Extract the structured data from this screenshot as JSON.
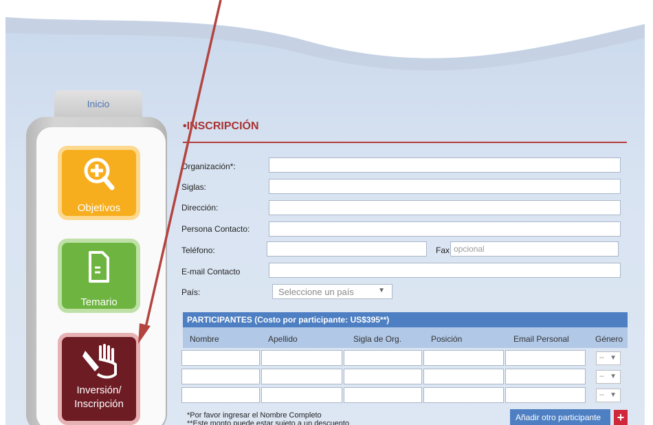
{
  "nav": {
    "home_tab": "Inicio",
    "tiles": [
      {
        "label": "Objetivos",
        "icon": "magnifier-plus-icon",
        "color": "#f7ae1e"
      },
      {
        "label": "Temario",
        "icon": "document-icon",
        "color": "#6eb440"
      },
      {
        "label_line1": "Inversión/",
        "label_line2": "Inscripción",
        "icon": "hand-writing-icon",
        "color": "#6d1c24"
      }
    ]
  },
  "form": {
    "title": "INSCRIPCIÓN",
    "fields": {
      "organizacion": "Organización*:",
      "siglas": "Siglas:",
      "direccion": "Dirección:",
      "persona": "Persona Contacto:",
      "telefono": "Teléfono:",
      "fax": "Fax:",
      "fax_placeholder": "opcional",
      "email": "E-mail Contacto",
      "pais": "País:",
      "pais_select": "Seleccione un país"
    }
  },
  "participants": {
    "header": "PARTICIPANTES (Costo por participante: US$395**)",
    "columns": [
      "Nombre",
      "Apellido",
      "Sigla de Org.",
      "Posición",
      "Email Personal",
      "Género"
    ],
    "gender_placeholder": "--",
    "note1": "*Por favor ingresar el Nombre Completo",
    "note2": "**Este monto puede estar sujeto a un descuento",
    "add_button": "Añadir otro participante",
    "plus": "+"
  },
  "colors": {
    "accent": "#a83232",
    "header_blue": "#4d7fc2",
    "annotation_arrow": "#b3443f"
  }
}
